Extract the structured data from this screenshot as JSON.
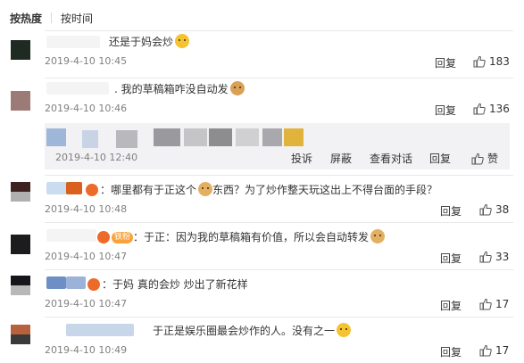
{
  "sort": {
    "active": "按热度",
    "other": "按时间"
  },
  "actions": {
    "reply": "回复",
    "report": "投诉",
    "block": "屏蔽",
    "view_conversation": "查看对话",
    "like": "赞"
  },
  "comments": [
    {
      "text": "还是于妈会炒",
      "emoji": "smile",
      "time": "2019-4-10 10:45",
      "likes": "183"
    },
    {
      "text": "我的草稿箱咋没自动发",
      "emoji": "cat",
      "time": "2019-4-10 10:46",
      "likes": "136"
    },
    {
      "text": "哪里都有于正这个",
      "text2": "东西？为了炒作整天玩这出上不得台面的手段？",
      "emoji": "dog",
      "time": "2019-4-10 10:48",
      "likes": "38"
    },
    {
      "fan_tag": "铁粉",
      "text": "于正：因为我的草稿箱有价值，所以会自动转发",
      "emoji": "dog",
      "time": "2019-4-10 10:47",
      "likes": "33"
    },
    {
      "text": "于妈 真的会炒 炒出了新花样",
      "time": "2019-4-10 10:47",
      "likes": "17"
    },
    {
      "text": "于正是娱乐圈最会炒作的人。没有之一",
      "emoji": "smile",
      "time": "2019-4-10 10:49",
      "likes": "17"
    }
  ],
  "reply": {
    "time": "2019-4-10 12:40"
  }
}
